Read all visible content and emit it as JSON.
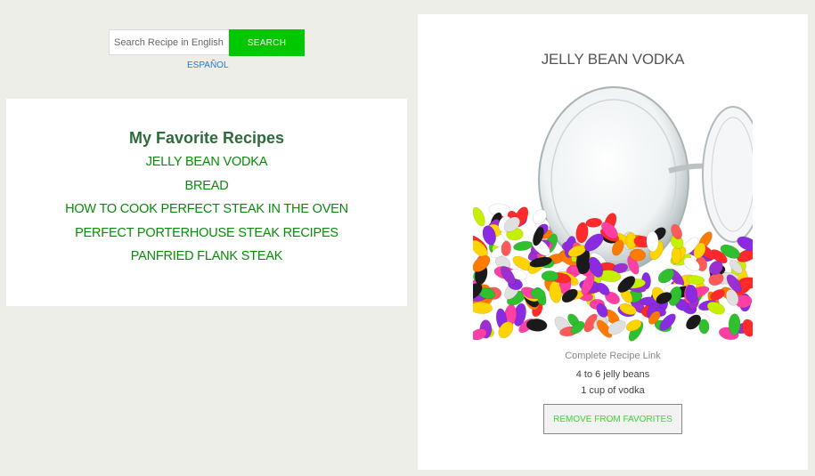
{
  "search": {
    "placeholder": "Search Recipe in English...",
    "button_label": "SEARCH",
    "language_link": "ESPAÑOL"
  },
  "favorites": {
    "title": "My Favorite Recipes",
    "items": [
      {
        "label": "JELLY BEAN VODKA"
      },
      {
        "label": "BREAD"
      },
      {
        "label": "HOW TO COOK PERFECT STEAK IN THE OVEN"
      },
      {
        "label": "PERFECT PORTERHOUSE STEAK RECIPES"
      },
      {
        "label": "PANFRIED FLANK STEAK"
      }
    ]
  },
  "detail": {
    "title": "JELLY BEAN VODKA",
    "complete_link": "Complete Recipe Link",
    "ingredients": [
      "4 to 6 jelly beans",
      "1 cup of vodka"
    ],
    "remove_label": "REMOVE FROM FAVORITES"
  },
  "colors": {
    "page_background": "#eeeee8",
    "search_button": "#00c800",
    "favorites_link": "#0a8a0a",
    "favorites_title": "#2d6b3a",
    "language_link": "#1a7bd6"
  }
}
